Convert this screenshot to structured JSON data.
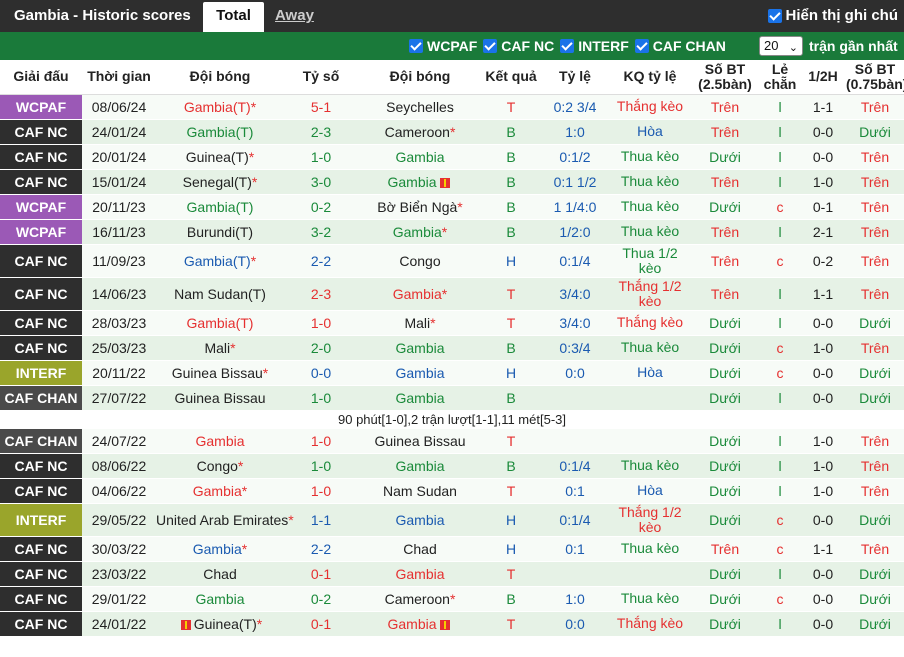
{
  "header": {
    "title": "Gambia - Historic scores",
    "tab_total": "Total",
    "tab_away": "Away",
    "show_label": "Hiển thị ghi chú"
  },
  "filters": {
    "items": [
      "WCPAF",
      "CAF NC",
      "INTERF",
      "CAF CHAN"
    ],
    "count_value": "20",
    "recent_label": "trận gần nhất"
  },
  "columns": {
    "league": "Giải đấu",
    "time": "Thời gian",
    "home": "Đội bóng",
    "score": "Tỷ số",
    "away": "Đội bóng",
    "result": "Kết quả",
    "ratio": "Tỷ lệ",
    "kq": "KQ tỷ lệ",
    "so_bt": "Số BT (2.5bàn)",
    "le_chan": "Lẻ chẵn",
    "half": "1/2H",
    "so_bt2": "Số BT (0.75bàn)"
  },
  "colors": {
    "WCPAF": "#9b59b6",
    "CAF NC": "#2e2e2e",
    "INTERF": "#9aa52b",
    "CAF CHAN": "#4a4a4a"
  },
  "rows": [
    {
      "league": "WCPAF",
      "date": "08/06/24",
      "home": "Gambia(T)",
      "home_star": true,
      "home_color": "red",
      "score": "5-1",
      "away": "Seychelles",
      "away_star": false,
      "away_color": "",
      "res": "T",
      "ratio": "0:2 3/4",
      "kq": "Thắng kèo",
      "bt": "Trên",
      "lc": "l",
      "h": "1-1",
      "bt2": "Trên"
    },
    {
      "league": "CAF NC",
      "date": "24/01/24",
      "home": "Gambia(T)",
      "home_star": false,
      "home_color": "grn",
      "score": "2-3",
      "away": "Cameroon",
      "away_star": true,
      "away_color": "",
      "res": "B",
      "ratio": "1:0",
      "kq": "Hòa",
      "bt": "Trên",
      "lc": "l",
      "h": "0-0",
      "bt2": "Dưới"
    },
    {
      "league": "CAF NC",
      "date": "20/01/24",
      "home": "Guinea(T)",
      "home_star": true,
      "home_color": "",
      "score": "1-0",
      "away": "Gambia",
      "away_star": false,
      "away_color": "grn",
      "res": "B",
      "ratio": "0:1/2",
      "kq": "Thua kèo",
      "bt": "Dưới",
      "lc": "l",
      "h": "0-0",
      "bt2": "Trên"
    },
    {
      "league": "CAF NC",
      "date": "15/01/24",
      "home": "Senegal(T)",
      "home_star": true,
      "home_color": "",
      "score": "3-0",
      "away": "Gambia",
      "away_star": false,
      "away_color": "grn",
      "away_flag": true,
      "res": "B",
      "ratio": "0:1 1/2",
      "kq": "Thua kèo",
      "bt": "Trên",
      "lc": "l",
      "h": "1-0",
      "bt2": "Trên"
    },
    {
      "league": "WCPAF",
      "date": "20/11/23",
      "home": "Gambia(T)",
      "home_star": false,
      "home_color": "grn",
      "score": "0-2",
      "away": "Bờ Biển Ngà",
      "away_star": true,
      "away_color": "",
      "res": "B",
      "ratio": "1 1/4:0",
      "kq": "Thua kèo",
      "bt": "Dưới",
      "lc": "c",
      "h": "0-1",
      "bt2": "Trên"
    },
    {
      "league": "WCPAF",
      "date": "16/11/23",
      "home": "Burundi(T)",
      "home_star": false,
      "home_color": "",
      "score": "3-2",
      "away": "Gambia",
      "away_star": true,
      "away_color": "grn",
      "res": "B",
      "ratio": "1/2:0",
      "kq": "Thua kèo",
      "bt": "Trên",
      "lc": "l",
      "h": "2-1",
      "bt2": "Trên"
    },
    {
      "league": "CAF NC",
      "date": "11/09/23",
      "home": "Gambia(T)",
      "home_star": true,
      "home_color": "blu",
      "score": "2-2",
      "away": "Congo",
      "away_star": false,
      "away_color": "",
      "res": "H",
      "ratio": "0:1/4",
      "kq": "Thua 1/2 kèo",
      "bt": "Trên",
      "lc": "c",
      "h": "0-2",
      "bt2": "Trên",
      "tall": true
    },
    {
      "league": "CAF NC",
      "date": "14/06/23",
      "home": "Nam Sudan(T)",
      "home_star": false,
      "home_color": "",
      "score": "2-3",
      "away": "Gambia",
      "away_star": true,
      "away_color": "red",
      "res": "T",
      "ratio": "3/4:0",
      "kq": "Thắng 1/2 kèo",
      "bt": "Trên",
      "lc": "l",
      "h": "1-1",
      "bt2": "Trên",
      "tall": true
    },
    {
      "league": "CAF NC",
      "date": "28/03/23",
      "home": "Gambia(T)",
      "home_star": false,
      "home_color": "red",
      "score": "1-0",
      "away": "Mali",
      "away_star": true,
      "away_color": "",
      "res": "T",
      "ratio": "3/4:0",
      "kq": "Thắng kèo",
      "bt": "Dưới",
      "lc": "l",
      "h": "0-0",
      "bt2": "Dưới"
    },
    {
      "league": "CAF NC",
      "date": "25/03/23",
      "home": "Mali",
      "home_star": true,
      "home_color": "",
      "score": "2-0",
      "away": "Gambia",
      "away_star": false,
      "away_color": "grn",
      "res": "B",
      "ratio": "0:3/4",
      "kq": "Thua kèo",
      "bt": "Dưới",
      "lc": "c",
      "h": "1-0",
      "bt2": "Trên"
    },
    {
      "league": "INTERF",
      "date": "20/11/22",
      "home": "Guinea Bissau",
      "home_star": true,
      "home_color": "",
      "score": "0-0",
      "away": "Gambia",
      "away_star": false,
      "away_color": "blu",
      "res": "H",
      "ratio": "0:0",
      "kq": "Hòa",
      "bt": "Dưới",
      "lc": "c",
      "h": "0-0",
      "bt2": "Dưới"
    },
    {
      "league": "CAF CHAN",
      "date": "27/07/22",
      "home": "Guinea Bissau",
      "home_star": false,
      "home_color": "",
      "score": "1-0",
      "away": "Gambia",
      "away_star": false,
      "away_color": "grn",
      "res": "B",
      "ratio": "",
      "kq": "",
      "bt": "Dưới",
      "lc": "l",
      "h": "0-0",
      "bt2": "Dưới"
    },
    {
      "note": "90 phút[1-0],2 trận lượt[1-1],11 mét[5-3]"
    },
    {
      "league": "CAF CHAN",
      "date": "24/07/22",
      "home": "Gambia",
      "home_star": false,
      "home_color": "red",
      "score": "1-0",
      "away": "Guinea Bissau",
      "away_star": false,
      "away_color": "",
      "res": "T",
      "ratio": "",
      "kq": "",
      "bt": "Dưới",
      "lc": "l",
      "h": "1-0",
      "bt2": "Trên"
    },
    {
      "league": "CAF NC",
      "date": "08/06/22",
      "home": "Congo",
      "home_star": true,
      "home_color": "",
      "score": "1-0",
      "away": "Gambia",
      "away_star": false,
      "away_color": "grn",
      "res": "B",
      "ratio": "0:1/4",
      "kq": "Thua kèo",
      "bt": "Dưới",
      "lc": "l",
      "h": "1-0",
      "bt2": "Trên"
    },
    {
      "league": "CAF NC",
      "date": "04/06/22",
      "home": "Gambia",
      "home_star": true,
      "home_color": "red",
      "score": "1-0",
      "away": "Nam Sudan",
      "away_star": false,
      "away_color": "",
      "res": "T",
      "ratio": "0:1",
      "kq": "Hòa",
      "bt": "Dưới",
      "lc": "l",
      "h": "1-0",
      "bt2": "Trên"
    },
    {
      "league": "INTERF",
      "date": "29/05/22",
      "home": "United Arab Emirates",
      "home_star": true,
      "home_color": "",
      "score": "1-1",
      "away": "Gambia",
      "away_star": false,
      "away_color": "blu",
      "res": "H",
      "ratio": "0:1/4",
      "kq": "Thắng 1/2 kèo",
      "bt": "Dưới",
      "lc": "c",
      "h": "0-0",
      "bt2": "Dưới",
      "tall": true
    },
    {
      "league": "CAF NC",
      "date": "30/03/22",
      "home": "Gambia",
      "home_star": true,
      "home_color": "blu",
      "score": "2-2",
      "away": "Chad",
      "away_star": false,
      "away_color": "",
      "res": "H",
      "ratio": "0:1",
      "kq": "Thua kèo",
      "bt": "Trên",
      "lc": "c",
      "h": "1-1",
      "bt2": "Trên"
    },
    {
      "league": "CAF NC",
      "date": "23/03/22",
      "home": "Chad",
      "home_star": false,
      "home_color": "",
      "score": "0-1",
      "away": "Gambia",
      "away_star": false,
      "away_color": "red",
      "res": "T",
      "ratio": "",
      "kq": "",
      "bt": "Dưới",
      "lc": "l",
      "h": "0-0",
      "bt2": "Dưới"
    },
    {
      "league": "CAF NC",
      "date": "29/01/22",
      "home": "Gambia",
      "home_star": false,
      "home_color": "grn",
      "score": "0-2",
      "away": "Cameroon",
      "away_star": true,
      "away_color": "",
      "res": "B",
      "ratio": "1:0",
      "kq": "Thua kèo",
      "bt": "Dưới",
      "lc": "c",
      "h": "0-0",
      "bt2": "Dưới"
    },
    {
      "league": "CAF NC",
      "date": "24/01/22",
      "home": "Guinea(T)",
      "home_star": true,
      "home_color": "",
      "home_flag": true,
      "score": "0-1",
      "away": "Gambia",
      "away_star": false,
      "away_color": "red",
      "away_flag": true,
      "res": "T",
      "ratio": "0:0",
      "kq": "Thắng kèo",
      "bt": "Dưới",
      "lc": "l",
      "h": "0-0",
      "bt2": "Dưới"
    }
  ]
}
